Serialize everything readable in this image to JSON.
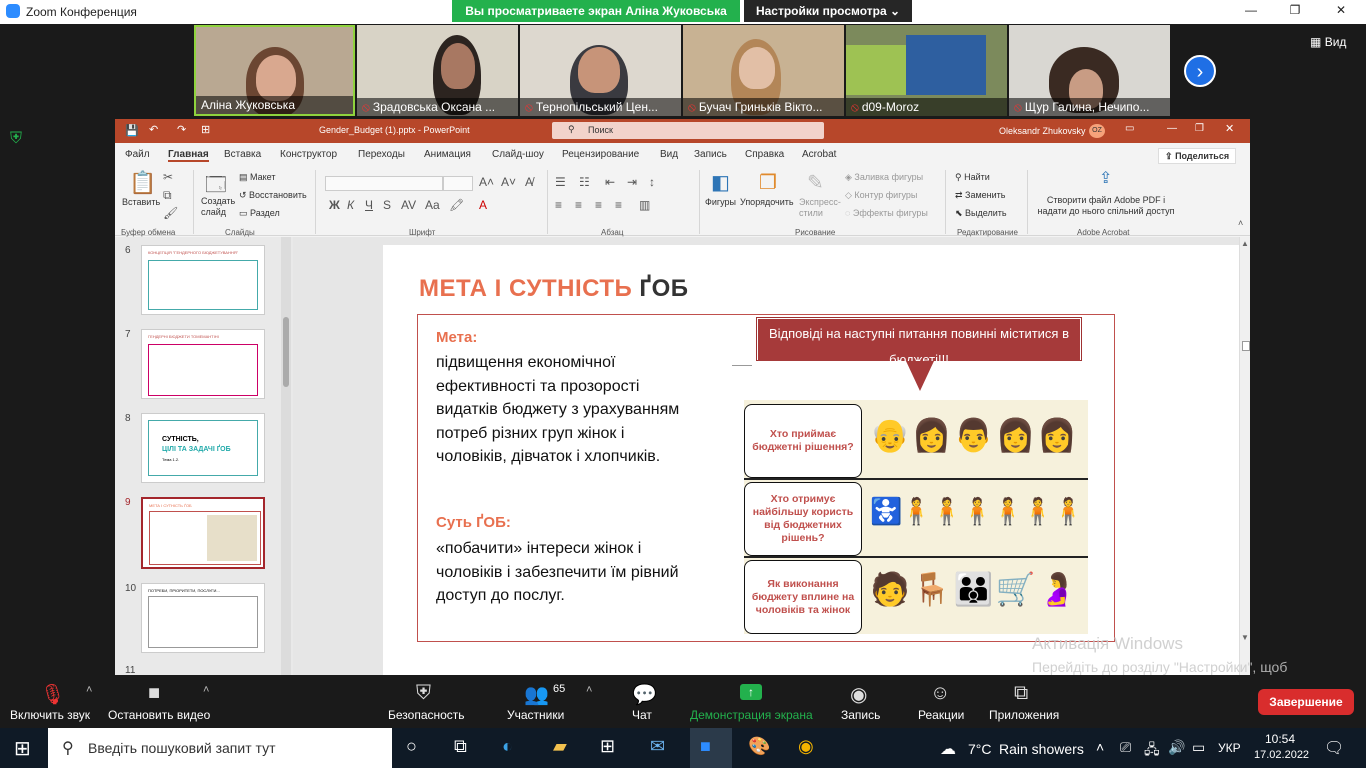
{
  "zoom": {
    "title": "Zoom Конференция",
    "share_banner": "Вы просматриваете экран Аліна Жуковська",
    "view_options": "Настройки просмотра",
    "view_label": "Вид",
    "participants": [
      {
        "name": "Аліна Жуковська",
        "muted": false
      },
      {
        "name": "Зрадовська Оксана ...",
        "muted": true
      },
      {
        "name": "Тернопільський Цен...",
        "muted": true
      },
      {
        "name": "Бучач Гриньків Вікто...",
        "muted": true
      },
      {
        "name": "d09-Moroz",
        "muted": true
      },
      {
        "name": "Щур Галина, Нечипо...",
        "muted": true
      }
    ],
    "toolbar": {
      "mute": "Включить звук",
      "video": "Остановить видео",
      "security": "Безопасность",
      "participants": "Участники",
      "participants_count": "65",
      "chat": "Чат",
      "share": "Демонстрация экрана",
      "record": "Запись",
      "reactions": "Реакции",
      "apps": "Приложения",
      "end": "Завершение"
    }
  },
  "powerpoint": {
    "file_title": "Gender_Budget (1).pptx  -  PowerPoint",
    "search_placeholder": "Поиск",
    "user": "Oleksandr Zhukovsky",
    "user_initials": "OZ",
    "menu": [
      "Файл",
      "Главная",
      "Вставка",
      "Конструктор",
      "Переходы",
      "Анимация",
      "Слайд-шоу",
      "Рецензирование",
      "Вид",
      "Запись",
      "Справка",
      "Acrobat"
    ],
    "share_button": "Поделиться",
    "ribbon": {
      "paste": "Вставить",
      "clipboard_group": "Буфер обмена",
      "new_slide": "Создать слайд",
      "layout": "Макет",
      "reset": "Восстановить",
      "section": "Раздел",
      "slides_group": "Слайды",
      "font_group": "Шрифт",
      "paragraph_group": "Абзац",
      "shapes": "Фигуры",
      "arrange": "Упорядочить",
      "quick_styles": "Экспресс-стили",
      "shape_fill": "Заливка фигуры",
      "shape_outline": "Контур фигуры",
      "shape_effects": "Эффекты фигуры",
      "drawing_group": "Рисование",
      "find": "Найти",
      "replace": "Заменить",
      "select": "Выделить",
      "editing_group": "Редактирование",
      "adobe_create": "Створити файл Adobe PDF і надати до нього спільний доступ",
      "adobe_group": "Adobe Acrobat"
    },
    "thumbnails": [
      {
        "num": "6",
        "title": "КОНЦЕПЦІЯ \"ГЕНДЕРНОГО БЮДЖЕТУВАННЯ\""
      },
      {
        "num": "7",
        "title": "ГЕНДЕРНІ БЮДЖЕТИ ТОМЕМАНТІНІ"
      },
      {
        "num": "8",
        "title_line1": "СУТНІСТЬ,",
        "title_line2": "ЦІЛІ ТА ЗАДАЧІ ҐОБ",
        "title_line3": "Тема 1.2."
      },
      {
        "num": "9",
        "title": "МЕТА І СУТНІСТЬ ҐОБ"
      },
      {
        "num": "10",
        "title": "ПОТРЕБИ, ПРІОРИТЕТИ, ПОСЛУГИ..."
      },
      {
        "num": "11",
        "title": ""
      }
    ],
    "slide": {
      "title_part1": "МЕТА",
      "title_part2": " І ",
      "title_part3": "СУТНІСТЬ",
      "title_part4": " ҐОБ",
      "goal_label": "Мета:",
      "goal_text": "підвищення економічної ефективності та прозорості видатків бюджету з урахуванням потреб різних груп жінок і чоловіків, дівчаток і хлопчиків.",
      "essence_label": "Суть ҐОБ:",
      "essence_text": "«побачити» інтереси жінок і чоловіків і забезпечити їм рівний доступ до послуг.",
      "banner": "Відповіді на наступні питання повинні міститися в бюджеті!!!",
      "questions": [
        "Хто приймає бюджетні рішення?",
        "Хто отримує найбільшу користь від бюджетних рішень?",
        "Як виконання бюджету вплине на чоловіків та жінок"
      ]
    }
  },
  "windows": {
    "activation_title": "Активація Windows",
    "activation_text": "Перейдіть до розділу \"Настройки\", щоб активувати Windows.",
    "search_placeholder": "Введіть пошуковий запит тут",
    "weather_temp": "7°C",
    "weather_text": "Rain showers",
    "language": "УКР",
    "time": "10:54",
    "date": "17.02.2022"
  },
  "colors": {
    "zoom_green": "#23b14d",
    "ppt_red": "#b7472a",
    "slide_accent": "#e8704f",
    "end_red": "#d92d2d"
  }
}
